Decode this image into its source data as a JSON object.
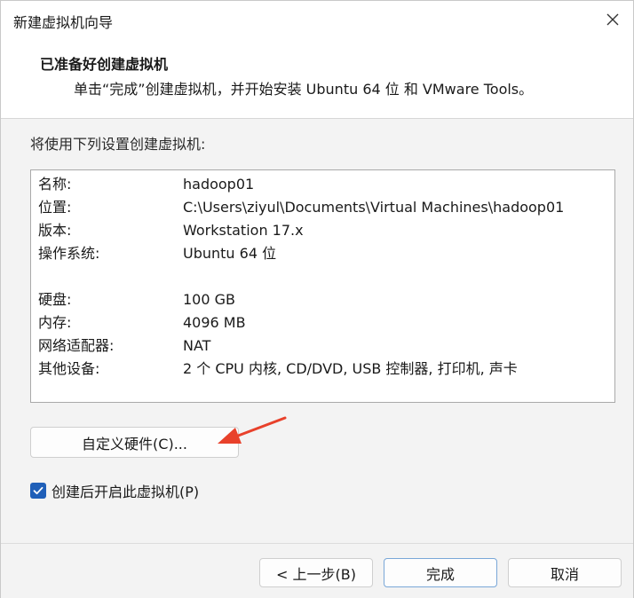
{
  "window": {
    "title": "新建虚拟机向导"
  },
  "header": {
    "title": "已准备好创建虚拟机",
    "subtitle": "单击“完成”创建虚拟机，并开始安装 Ubuntu 64 位 和 VMware Tools。"
  },
  "main": {
    "intro": "将使用下列设置创建虚拟机:",
    "settings": [
      {
        "key": "名称:",
        "value": "hadoop01"
      },
      {
        "key": "位置:",
        "value": "C:\\Users\\ziyul\\Documents\\Virtual Machines\\hadoop01"
      },
      {
        "key": "版本:",
        "value": "Workstation 17.x"
      },
      {
        "key": "操作系统:",
        "value": "Ubuntu 64 位"
      },
      {
        "key": "硬盘:",
        "value": "100 GB"
      },
      {
        "key": "内存:",
        "value": "4096 MB"
      },
      {
        "key": "网络适配器:",
        "value": "NAT"
      },
      {
        "key": "其他设备:",
        "value": "2 个 CPU 内核, CD/DVD, USB 控制器, 打印机, 声卡"
      }
    ],
    "customize_button": "自定义硬件(C)...",
    "power_on_checkbox": {
      "label": "创建后开启此虚拟机(P)",
      "checked": true
    }
  },
  "footer": {
    "back_label": "< 上一步(B)",
    "finish_label": "完成",
    "cancel_label": "取消"
  },
  "colors": {
    "accent": "#1f5fb8",
    "annotation_arrow": "#e8412b"
  },
  "icons": {
    "close": "close-icon",
    "checkmark": "checkmark-icon"
  }
}
